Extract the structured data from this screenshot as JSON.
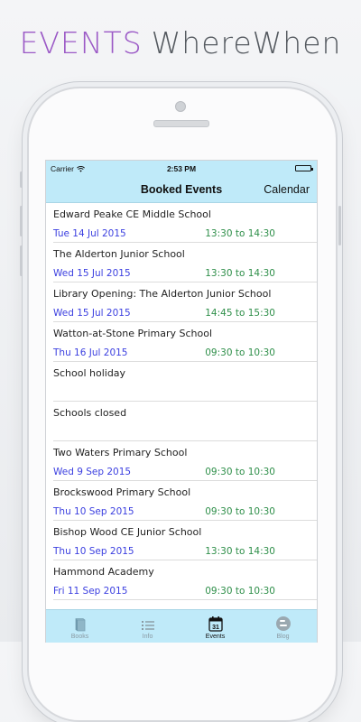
{
  "promo": {
    "word1": "EVENTS",
    "word2": "WhereWhen"
  },
  "statusbar": {
    "carrier": "Carrier",
    "time": "2:53 PM"
  },
  "navbar": {
    "title": "Booked Events",
    "right_button": "Calendar"
  },
  "events": [
    {
      "name": "Edward Peake CE Middle School",
      "date": "Tue 14 Jul 2015",
      "time": "13:30 to 14:30"
    },
    {
      "name": "The Alderton Junior School",
      "date": "Wed 15 Jul 2015",
      "time": "13:30 to 14:30"
    },
    {
      "name": "Library Opening: The Alderton Junior School",
      "date": "Wed 15 Jul 2015",
      "time": "14:45 to 15:30"
    },
    {
      "name": "Watton-at-Stone Primary School",
      "date": "Thu 16 Jul 2015",
      "time": "09:30 to 10:30"
    },
    {
      "name": "School holiday",
      "date": "",
      "time": ""
    },
    {
      "name": "Schools closed",
      "date": "",
      "time": ""
    },
    {
      "name": "Two Waters Primary School",
      "date": "Wed 9 Sep 2015",
      "time": "09:30 to 10:30"
    },
    {
      "name": "Brockswood Primary School",
      "date": "Thu 10 Sep 2015",
      "time": "09:30 to 10:30"
    },
    {
      "name": "Bishop Wood CE Junior School",
      "date": "Thu 10 Sep 2015",
      "time": "13:30 to 14:30"
    },
    {
      "name": "Hammond Academy",
      "date": "Fri 11 Sep 2015",
      "time": "09:30 to 10:30"
    }
  ],
  "tabbar": {
    "items": [
      {
        "label": "Books",
        "icon": "book-icon"
      },
      {
        "label": "Info",
        "icon": "list-icon"
      },
      {
        "label": "Events",
        "icon": "calendar-icon",
        "badge": "31"
      },
      {
        "label": "Blog",
        "icon": "blogger-icon"
      }
    ],
    "active": "Events"
  },
  "colors": {
    "bar_background": "#bfeaf9",
    "date_text": "#3b3fe0",
    "time_text": "#2f8f4a",
    "promo_accent": "#9b59c6"
  }
}
